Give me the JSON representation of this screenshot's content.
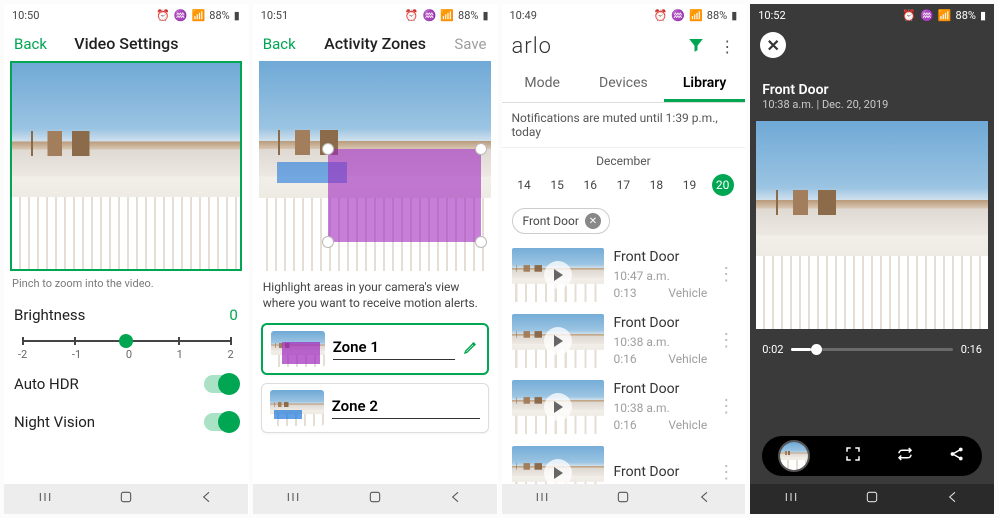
{
  "status": {
    "battery": "88%",
    "icons": "⏰ ♒ 📶"
  },
  "screens": [
    {
      "time": "10:50",
      "back": "Back",
      "title": "Video Settings",
      "hint": "Pinch to zoom into the video.",
      "brightness": {
        "label": "Brightness",
        "value": "0",
        "ticks": [
          "-2",
          "-1",
          "0",
          "1",
          "2"
        ]
      },
      "rows": [
        {
          "label": "Auto HDR"
        },
        {
          "label": "Night Vision"
        }
      ]
    },
    {
      "time": "10:51",
      "back": "Back",
      "title": "Activity Zones",
      "save": "Save",
      "desc": "Highlight areas in your camera's view where you want to receive motion alerts.",
      "zones": [
        {
          "name": "Zone 1"
        },
        {
          "name": "Zone 2"
        }
      ]
    },
    {
      "time": "10:49",
      "logo": "arlo",
      "tabs": [
        "Mode",
        "Devices",
        "Library"
      ],
      "activeTab": 2,
      "mute": "Notifications are muted until 1:39 p.m., today",
      "month": "December",
      "dates": [
        "14",
        "15",
        "16",
        "17",
        "18",
        "19",
        "20"
      ],
      "selDate": 6,
      "chip": "Front Door",
      "clips": [
        {
          "name": "Front Door",
          "time": "10:47 a.m.",
          "dur": "0:13",
          "tag": "Vehicle"
        },
        {
          "name": "Front Door",
          "time": "10:38 a.m.",
          "dur": "0:16",
          "tag": "Vehicle"
        },
        {
          "name": "Front Door",
          "time": "10:38 a.m.",
          "dur": "0:16",
          "tag": "Vehicle"
        },
        {
          "name": "Front Door",
          "time": "",
          "dur": "",
          "tag": ""
        }
      ]
    },
    {
      "time": "10:52",
      "name": "Front Door",
      "stamp": "10:38 a.m. | Dec. 20, 2019",
      "pos": "0:02",
      "dur": "0:16"
    }
  ]
}
